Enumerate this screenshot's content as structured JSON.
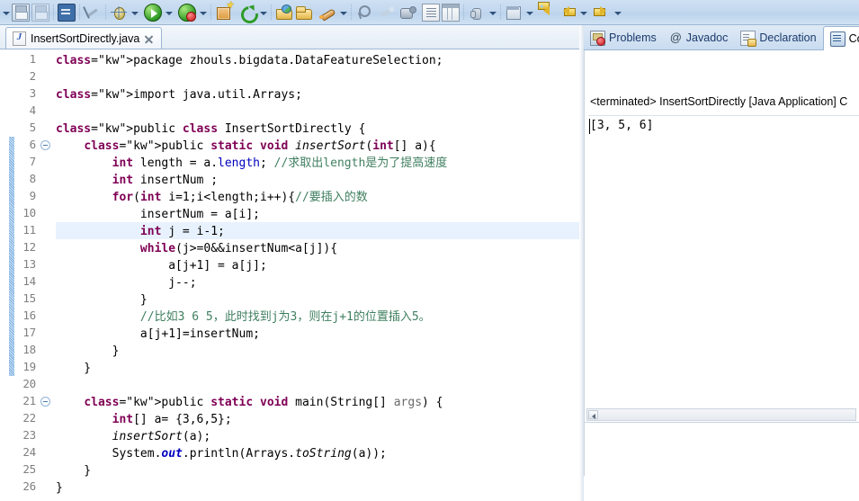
{
  "toolbar": {
    "items": [
      {
        "name": "toolbar-dropdown-arrow-0",
        "kind": "arrow",
        "label": ""
      },
      {
        "name": "save-button",
        "kind": "icon",
        "icon": "save-icon",
        "label": "Save"
      },
      {
        "name": "save-all-button",
        "kind": "icon",
        "icon": "save-all-icon",
        "label": "Save All"
      },
      {
        "name": "toolbar-separator-1",
        "kind": "sep",
        "label": ""
      },
      {
        "name": "open-console-button",
        "kind": "icon",
        "icon": "console-icon",
        "label": "Console"
      },
      {
        "name": "toolbar-separator-2",
        "kind": "sep",
        "label": ""
      },
      {
        "name": "toggle-link-button",
        "kind": "icon",
        "icon": "no-link-icon",
        "label": "Link with Editor"
      },
      {
        "name": "toolbar-separator-3",
        "kind": "sep",
        "label": ""
      },
      {
        "name": "debug-button",
        "kind": "icon",
        "icon": "debug-bug-icon",
        "label": "Debug"
      },
      {
        "name": "debug-dropdown-arrow",
        "kind": "arrow",
        "label": ""
      },
      {
        "name": "run-button",
        "kind": "icon",
        "icon": "run-play-icon",
        "label": "Run"
      },
      {
        "name": "run-dropdown-arrow",
        "kind": "arrow",
        "label": ""
      },
      {
        "name": "external-tools-button",
        "kind": "icon",
        "icon": "external-tools-icon",
        "label": "External Tools"
      },
      {
        "name": "external-tools-dropdown-arrow",
        "kind": "arrow",
        "label": ""
      },
      {
        "name": "toolbar-separator-4",
        "kind": "sep",
        "label": ""
      },
      {
        "name": "new-wizard-button",
        "kind": "icon",
        "icon": "new-wizard-icon",
        "label": "New"
      },
      {
        "name": "refresh-button",
        "kind": "icon",
        "icon": "refresh-icon",
        "label": "Refresh"
      },
      {
        "name": "refresh-dropdown-arrow",
        "kind": "arrow",
        "label": ""
      },
      {
        "name": "toolbar-separator-5",
        "kind": "sep",
        "label": ""
      },
      {
        "name": "open-type-button",
        "kind": "icon",
        "icon": "open-folder-blue-icon",
        "label": "Open Type"
      },
      {
        "name": "open-resource-button",
        "kind": "icon",
        "icon": "open-folder-icon",
        "label": "Open Resource"
      },
      {
        "name": "rocket-button",
        "kind": "icon",
        "icon": "rocket-icon",
        "label": "Launch"
      },
      {
        "name": "rocket-dropdown-arrow",
        "kind": "arrow",
        "label": ""
      },
      {
        "name": "toolbar-separator-6",
        "kind": "sep",
        "label": ""
      },
      {
        "name": "search-button",
        "kind": "icon",
        "icon": "search-pin-icon",
        "label": "Search"
      },
      {
        "name": "brush-button",
        "kind": "icon",
        "icon": "brush-icon",
        "label": "Clean"
      },
      {
        "name": "annotate-button",
        "kind": "icon",
        "icon": "annotate-icon",
        "label": "Annotate"
      },
      {
        "name": "outline-button",
        "kind": "icon",
        "icon": "document-lines-icon",
        "label": "Outline"
      },
      {
        "name": "table-button",
        "kind": "icon",
        "icon": "table-columns-icon",
        "label": "Table"
      },
      {
        "name": "toolbar-separator-7",
        "kind": "sep",
        "label": ""
      },
      {
        "name": "pointer-button",
        "kind": "icon",
        "icon": "hand-pointer-icon",
        "label": "Select"
      },
      {
        "name": "pointer-dropdown-arrow",
        "kind": "arrow",
        "label": ""
      },
      {
        "name": "toolbar-separator-8",
        "kind": "sep",
        "label": ""
      },
      {
        "name": "perspective-button",
        "kind": "icon",
        "icon": "perspective-window-icon",
        "label": "Open Perspective"
      },
      {
        "name": "perspective-dropdown-arrow",
        "kind": "arrow",
        "label": ""
      },
      {
        "name": "back-button",
        "kind": "icon",
        "icon": "back-arrow-icon",
        "label": "Back"
      },
      {
        "name": "back-history-button",
        "kind": "icon",
        "icon": "back-arrow-icon",
        "label": "Back History"
      },
      {
        "name": "back-dropdown-arrow",
        "kind": "arrow",
        "label": ""
      },
      {
        "name": "forward-button",
        "kind": "icon",
        "icon": "forward-arrow-icon",
        "label": "Forward"
      },
      {
        "name": "forward-dropdown-arrow",
        "kind": "arrow",
        "label": ""
      }
    ]
  },
  "editor": {
    "tab": {
      "filename": "InsertSortDirectly.java",
      "file_icon": "java-file-icon",
      "close_icon": "close-icon"
    },
    "cursor_line": 11,
    "change_bar_start_line": 6,
    "change_bar_end_line": 19,
    "fold_lines": [
      6,
      21
    ],
    "line_count": 26,
    "lines": [
      {
        "n": 1,
        "text": "package zhouls.bigdata.DataFeatureSelection;"
      },
      {
        "n": 2,
        "text": ""
      },
      {
        "n": 3,
        "text": "import java.util.Arrays;"
      },
      {
        "n": 4,
        "text": ""
      },
      {
        "n": 5,
        "text": "public class InsertSortDirectly {"
      },
      {
        "n": 6,
        "text": "    public static void insertSort(int[] a){"
      },
      {
        "n": 7,
        "text": "        int length = a.length; //求取出length是为了提高速度"
      },
      {
        "n": 8,
        "text": "        int insertNum ;"
      },
      {
        "n": 9,
        "text": "        for(int i=1;i<length;i++){//要插入的数"
      },
      {
        "n": 10,
        "text": "            insertNum = a[i];"
      },
      {
        "n": 11,
        "text": "            int j = i-1;"
      },
      {
        "n": 12,
        "text": "            while(j>=0&&insertNum<a[j]){"
      },
      {
        "n": 13,
        "text": "                a[j+1] = a[j];"
      },
      {
        "n": 14,
        "text": "                j--;"
      },
      {
        "n": 15,
        "text": "            }"
      },
      {
        "n": 16,
        "text": "            //比如3 6 5，此时找到j为3，则在j+1的位置插入5。"
      },
      {
        "n": 17,
        "text": "            a[j+1]=insertNum;"
      },
      {
        "n": 18,
        "text": "        }"
      },
      {
        "n": 19,
        "text": "    }"
      },
      {
        "n": 20,
        "text": ""
      },
      {
        "n": 21,
        "text": "    public static void main(String[] args) {"
      },
      {
        "n": 22,
        "text": "        int[] a= {3,6,5};"
      },
      {
        "n": 23,
        "text": "        insertSort(a);"
      },
      {
        "n": 24,
        "text": "        System.out.println(Arrays.toString(a));"
      },
      {
        "n": 25,
        "text": "    }"
      },
      {
        "n": 26,
        "text": "}"
      }
    ]
  },
  "right_panel": {
    "tabs": [
      {
        "label": "Problems",
        "icon": "problems-icon",
        "active": false
      },
      {
        "label": "Javadoc",
        "icon": "javadoc-at-icon",
        "active": false
      },
      {
        "label": "Declaration",
        "icon": "declaration-icon",
        "active": false
      },
      {
        "label": "Con",
        "icon": "console-tab-icon",
        "active": true
      }
    ],
    "console": {
      "header": "<terminated> InsertSortDirectly [Java Application] C",
      "output": "[3, 5, 6]",
      "hscroll_left_icon": "scroll-left-icon"
    }
  },
  "colors": {
    "keyword": "#7f0055",
    "comment": "#3f7f5f",
    "field": "#0000c0",
    "line_number": "#808080",
    "cursor_line_highlight": "#e8f2fe",
    "change_bar": "#9cc4e8",
    "toolbar_bg": "#c3d8ef",
    "tab_border": "#9bb6d4"
  }
}
